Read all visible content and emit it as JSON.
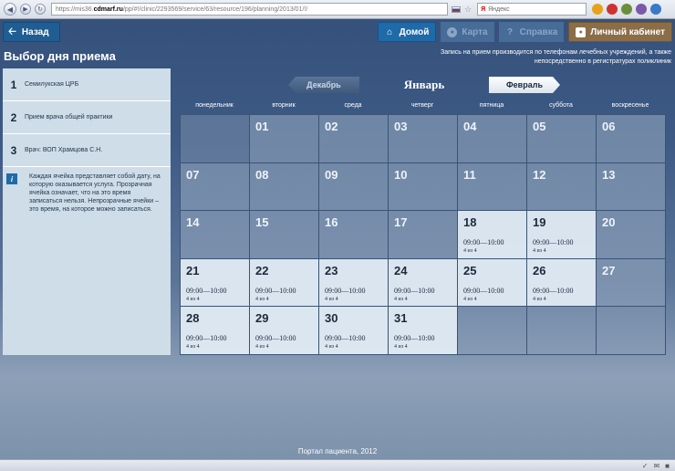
{
  "browser": {
    "url_prefix": "https://mis36.",
    "url_host": "cdmarf.ru",
    "url_path": "/pp/#!/clinic/2293569/service/63/resource/196/planning/2013/01/!/",
    "search_placeholder": "Яндекс",
    "search_logo": "Я"
  },
  "topbar": {
    "back_label": "Назад",
    "home_label": "Домой",
    "map_label": "Карта",
    "help_label": "Справка",
    "cabinet_label": "Личный кабинет"
  },
  "page": {
    "title": "Выбор дня приема",
    "notice": "Запись на прием производится по телефонам лечебных учреждений, а также непосредственно в регистратурах поликлиник"
  },
  "steps": [
    {
      "num": "1",
      "label": "Семилукская ЦРБ"
    },
    {
      "num": "2",
      "label": "Прием врача общей практики"
    },
    {
      "num": "3",
      "label": "Врач: ВОП Храмцова С.Н."
    }
  ],
  "info_text": "Каждая ячейка представляет собой дату, на которую оказывается услуга. Прозрачная ячейка означает, что на это время записаться нельзя. Непрозрачные ячейки – это время, на которое можно записаться.",
  "month_nav": {
    "prev": "Декабрь",
    "current": "Январь",
    "next": "Февраль"
  },
  "weekdays": [
    "понедельник",
    "вторник",
    "среда",
    "четверг",
    "пятница",
    "суббота",
    "воскресенье"
  ],
  "calendar": [
    {
      "day": "",
      "active": false,
      "slot": "",
      "count": ""
    },
    {
      "day": "01",
      "active": false,
      "slot": "",
      "count": ""
    },
    {
      "day": "02",
      "active": false,
      "slot": "",
      "count": ""
    },
    {
      "day": "03",
      "active": false,
      "slot": "",
      "count": ""
    },
    {
      "day": "04",
      "active": false,
      "slot": "",
      "count": ""
    },
    {
      "day": "05",
      "active": false,
      "slot": "",
      "count": ""
    },
    {
      "day": "06",
      "active": false,
      "slot": "",
      "count": ""
    },
    {
      "day": "07",
      "active": false,
      "slot": "",
      "count": ""
    },
    {
      "day": "08",
      "active": false,
      "slot": "",
      "count": ""
    },
    {
      "day": "09",
      "active": false,
      "slot": "",
      "count": ""
    },
    {
      "day": "10",
      "active": false,
      "slot": "",
      "count": ""
    },
    {
      "day": "11",
      "active": false,
      "slot": "",
      "count": ""
    },
    {
      "day": "12",
      "active": false,
      "slot": "",
      "count": ""
    },
    {
      "day": "13",
      "active": false,
      "slot": "",
      "count": ""
    },
    {
      "day": "14",
      "active": false,
      "slot": "",
      "count": ""
    },
    {
      "day": "15",
      "active": false,
      "slot": "",
      "count": ""
    },
    {
      "day": "16",
      "active": false,
      "slot": "",
      "count": ""
    },
    {
      "day": "17",
      "active": false,
      "slot": "",
      "count": ""
    },
    {
      "day": "18",
      "active": true,
      "slot": "09:00—10:00",
      "count": "4 из 4"
    },
    {
      "day": "19",
      "active": true,
      "slot": "09:00—10:00",
      "count": "4 из 4"
    },
    {
      "day": "20",
      "active": false,
      "slot": "",
      "count": ""
    },
    {
      "day": "21",
      "active": true,
      "slot": "09:00—10:00",
      "count": "4 из 4"
    },
    {
      "day": "22",
      "active": true,
      "slot": "09:00—10:00",
      "count": "4 из 4"
    },
    {
      "day": "23",
      "active": true,
      "slot": "09:00—10:00",
      "count": "4 из 4"
    },
    {
      "day": "24",
      "active": true,
      "slot": "09:00—10:00",
      "count": "4 из 4"
    },
    {
      "day": "25",
      "active": true,
      "slot": "09:00—10:00",
      "count": "4 из 4"
    },
    {
      "day": "26",
      "active": true,
      "slot": "09:00—10:00",
      "count": "4 из 4"
    },
    {
      "day": "27",
      "active": false,
      "slot": "",
      "count": ""
    },
    {
      "day": "28",
      "active": true,
      "slot": "09:00—10:00",
      "count": "4 из 4"
    },
    {
      "day": "29",
      "active": true,
      "slot": "09:00—10:00",
      "count": "4 из 4"
    },
    {
      "day": "30",
      "active": true,
      "slot": "09:00—10:00",
      "count": "4 из 4"
    },
    {
      "day": "31",
      "active": true,
      "slot": "09:00—10:00",
      "count": "4 из 4"
    },
    {
      "day": "",
      "active": false,
      "slot": "",
      "count": ""
    },
    {
      "day": "",
      "active": false,
      "slot": "",
      "count": ""
    },
    {
      "day": "",
      "active": false,
      "slot": "",
      "count": ""
    }
  ],
  "footer": "Портал пациента, 2012",
  "colors": {
    "back_button": "#1f5d93",
    "home_button": "#1f6aa8",
    "cabinet_button": "#8b6d47",
    "active_cell": "#e2ebf3",
    "inactive_cell": "#90a3bb"
  }
}
